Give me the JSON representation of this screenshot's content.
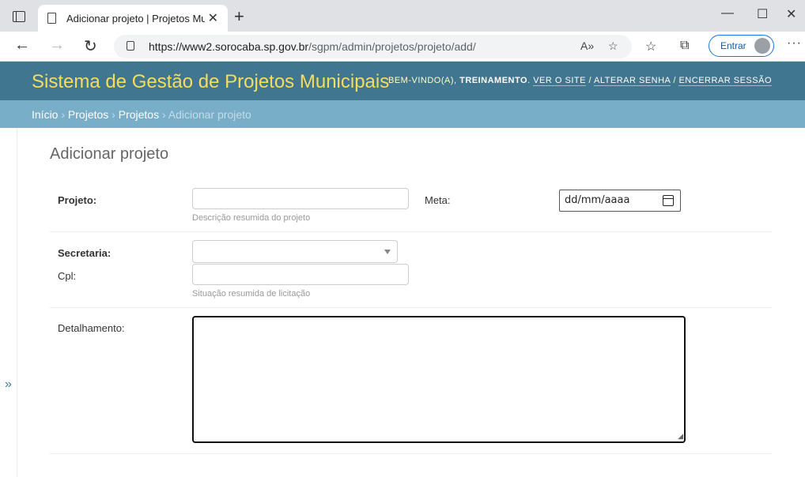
{
  "browser": {
    "tab_title": "Adicionar projeto | Projetos Mun",
    "url_host": "https://www2.sorocaba.sp.gov.br",
    "url_path": "/sgpm/admin/projetos/projeto/add/",
    "signin_label": "Entrar"
  },
  "header": {
    "brand": "Sistema de Gestão de Projetos Municipais",
    "welcome": "BEM-VINDO(A),",
    "username": "TREINAMENTO",
    "view_site": "VER O SITE",
    "change_password": "ALTERAR SENHA",
    "logout": "ENCERRAR SESSÃO"
  },
  "breadcrumbs": {
    "home": "Início",
    "app": "Projetos",
    "model": "Projetos",
    "current": "Adicionar projeto"
  },
  "form": {
    "title": "Adicionar projeto",
    "projeto_label": "Projeto:",
    "projeto_help": "Descrição resumida do projeto",
    "meta_label": "Meta:",
    "meta_placeholder": "dd/mm/aaaa",
    "secretaria_label": "Secretaria:",
    "cpl_label": "Cpl:",
    "cpl_help": "Situação resumida de licitação",
    "detalhamento_label": "Detalhamento:"
  },
  "sidebar": {
    "toggle_label": "»"
  }
}
